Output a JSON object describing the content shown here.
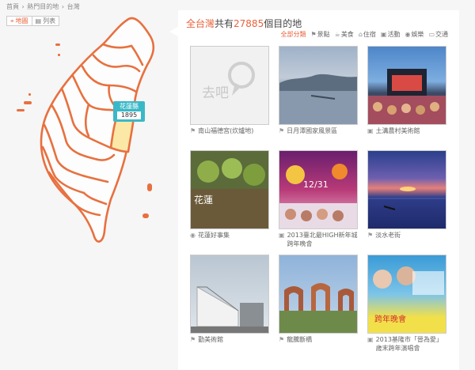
{
  "breadcrumb": [
    "首頁",
    "›",
    "熱門目的地",
    "›",
    "台灣"
  ],
  "view_toggle": {
    "map_label": "地圖",
    "list_label": "列表"
  },
  "map": {
    "highlight_region": {
      "name": "花蓮縣",
      "count": "1895"
    },
    "stroke_color": "#e8703f",
    "highlight_color": "#fce8a6"
  },
  "panel": {
    "title_prefix": "全台灣",
    "title_middle": "共有",
    "title_count": "27885",
    "title_suffix": "個目的地",
    "categories": [
      {
        "label": "全部分類",
        "icon": "none",
        "active": true
      },
      {
        "label": "景點",
        "icon": "scenery-icon",
        "active": false
      },
      {
        "label": "美食",
        "icon": "food-icon",
        "active": false
      },
      {
        "label": "住宿",
        "icon": "lodging-icon",
        "active": false
      },
      {
        "label": "活動",
        "icon": "event-icon",
        "active": false
      },
      {
        "label": "娛樂",
        "icon": "entertainment-icon",
        "active": false
      },
      {
        "label": "交通",
        "icon": "transport-icon",
        "active": false
      }
    ],
    "cards": [
      {
        "title": "南山福德宮(炊爐地)",
        "icon": "scenery-icon"
      },
      {
        "title": "日月潭國家風景區",
        "icon": "scenery-icon"
      },
      {
        "title": "土溝農村美術館",
        "icon": "event-icon"
      },
      {
        "title": "花蓮好事集",
        "icon": "entertainment-icon"
      },
      {
        "title": "2013臺北最HIGH新年城跨年晚會",
        "icon": "event-icon"
      },
      {
        "title": "淡水老街",
        "icon": "scenery-icon"
      },
      {
        "title": "勤美術館",
        "icon": "scenery-icon"
      },
      {
        "title": "龍騰斷橋",
        "icon": "scenery-icon"
      },
      {
        "title": "2013基隆市「晉為愛」歲末跨年演唱會",
        "icon": "event-icon"
      }
    ],
    "thumb_text": {
      "placeholder_logo": "去吧",
      "hualien_banner": "花蓮",
      "countdown": "12/31",
      "keelung_line1": "跨年晚會"
    }
  }
}
